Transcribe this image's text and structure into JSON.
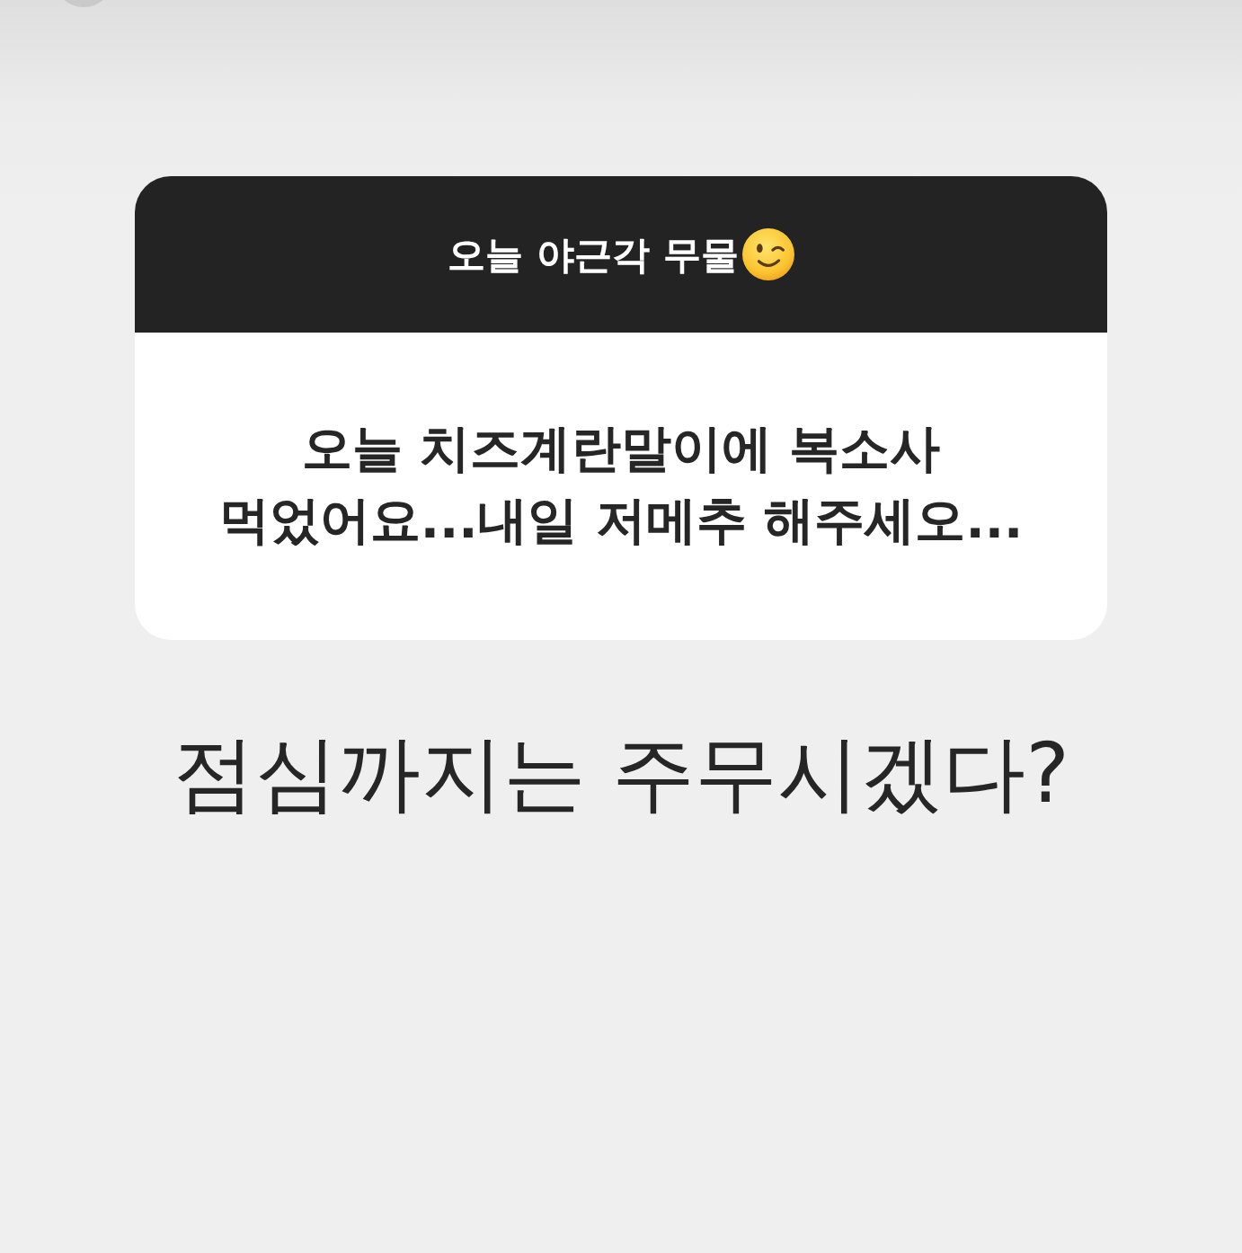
{
  "question_sticker": {
    "prompt": "오늘 야근각 무물",
    "question": "오늘 치즈계란말이에 복소사 먹었어요...내일 저메추 해주세오..."
  },
  "reply_text": "점심까지는 주무시겠다?"
}
